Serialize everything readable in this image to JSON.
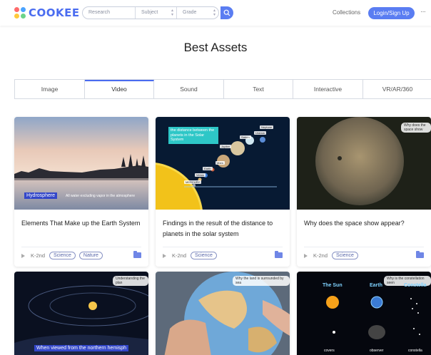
{
  "header": {
    "logo": "COOKEE",
    "search": {
      "research_placeholder": "Research",
      "subject_placeholder": "Subject",
      "grade_placeholder": "Grade"
    },
    "collections": "Collections",
    "login": "Login/Sign Up",
    "more": "···"
  },
  "page_title": "Best Assets",
  "tabs": [
    "Image",
    "Video",
    "Sound",
    "Text",
    "Interactive",
    "VR/AR/360"
  ],
  "active_tab": "Video",
  "cards": [
    {
      "title": "Elements That Make up the Earth System",
      "grade": "K-2nd",
      "tags": [
        "Science",
        "Nature"
      ],
      "thumb_tag": "Hydrosphere",
      "thumb_caption": "All water excluding vapor in the atmosphere"
    },
    {
      "title": "Findings in the result of the distance to planets in the solar system",
      "grade": "K-2nd",
      "tags": [
        "Science"
      ],
      "thumb_heading": "the distance between the planets in the Solar System",
      "planets": [
        "Neptune",
        "Uranus",
        "Saturn",
        "Jupiter",
        "Mars",
        "Earth",
        "Venus",
        "MERCURY"
      ]
    },
    {
      "title": "Why does the space show appear?",
      "grade": "K-2nd",
      "tags": [
        "Science"
      ],
      "thumb_badge": "Why does the space show"
    }
  ],
  "lower_cards": [
    {
      "badge": "Understanding the plan",
      "caption": "When viewed from the northern hemisph"
    },
    {
      "badge": "Why the land is surrounded by sea"
    },
    {
      "badge": "Why is the constellation seen",
      "labels": [
        "The Sun",
        "Earth",
        "Constella"
      ],
      "bottom_labels": [
        "covers",
        "observer",
        "constella"
      ]
    }
  ],
  "colors": {
    "accent": "#4a6cf0",
    "button": "#5a7df2"
  }
}
